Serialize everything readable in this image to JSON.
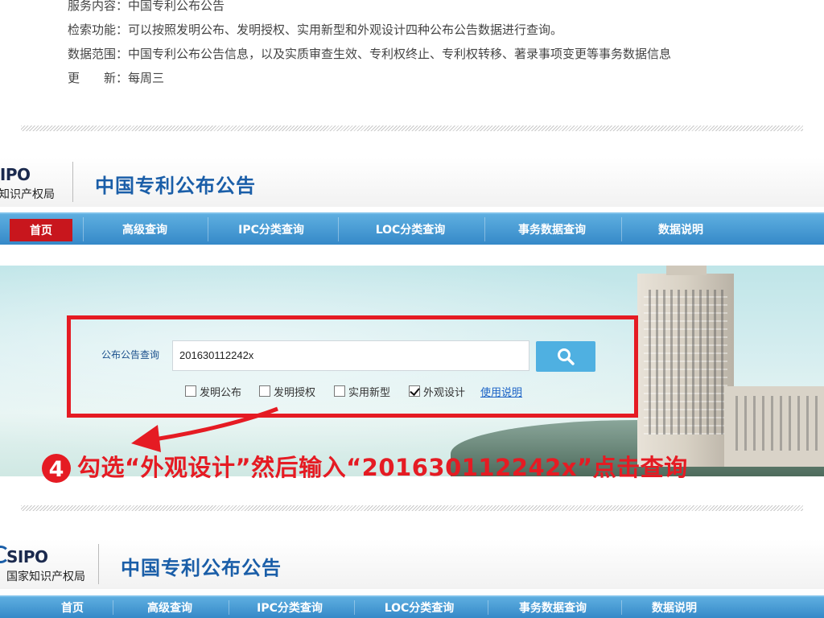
{
  "info": {
    "lines": [
      {
        "label": "服务内容：",
        "value": "中国专利公布公告"
      },
      {
        "label": "检索功能：",
        "value": "可以按照发明公布、发明授权、实用新型和外观设计四种公布公告数据进行查询。"
      },
      {
        "label": "数据范围：",
        "value": "中国专利公布公告信息，以及实质审查生效、专利权终止、专利权转移、著录事项变更等事务数据信息"
      },
      {
        "label": "更　　新：",
        "value": "每周三"
      }
    ]
  },
  "header": {
    "logo_en": "SIPO",
    "logo_cn": "国家知识产权局",
    "title": "中国专利公布公告"
  },
  "nav": {
    "items": [
      "首页",
      "高级查询",
      "IPC分类查询",
      "LOC分类查询",
      "事务数据查询",
      "数据说明"
    ]
  },
  "search": {
    "label": "公布公告查询",
    "value": "201630112242x",
    "checkboxes": [
      {
        "label": "发明公布",
        "checked": false
      },
      {
        "label": "发明授权",
        "checked": false
      },
      {
        "label": "实用新型",
        "checked": false
      },
      {
        "label": "外观设计",
        "checked": true
      }
    ],
    "help_link": "使用说明"
  },
  "annotation": {
    "step": "4",
    "text": "勾选“外观设计”然后输入“201630112242x”点击查询"
  },
  "colors": {
    "accent_red": "#e51b23",
    "nav_blue": "#3589c8",
    "title_blue": "#1a5ea8",
    "search_button": "#4fb0e1"
  },
  "icons": {
    "search": "magnifier-icon"
  }
}
